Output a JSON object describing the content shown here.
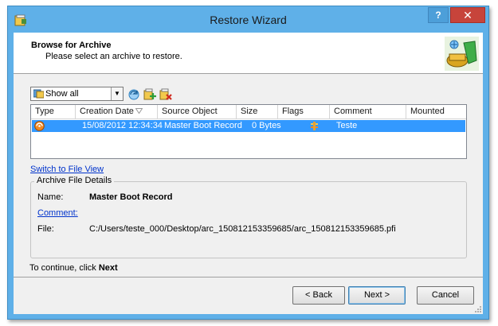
{
  "window": {
    "title": "Restore Wizard",
    "help_label": "?",
    "close_label": "✕"
  },
  "header": {
    "title": "Browse for Archive",
    "subtitle": "Please select an archive to restore."
  },
  "toolbar": {
    "filter_value": "Show all"
  },
  "list": {
    "columns": [
      "Type",
      "Creation Date",
      "Source Object",
      "Size",
      "Flags",
      "Comment",
      "Mounted"
    ],
    "rows": [
      {
        "type_icon": "archive-icon",
        "creation_date": "15/08/2012 12:34:34",
        "source_object": "Master Boot Record",
        "size": "0 Bytes",
        "flags_icon": "flag-icon",
        "comment": "Teste",
        "mounted": ""
      }
    ]
  },
  "links": {
    "switch_view": "Switch to File View"
  },
  "details": {
    "group_title": "Archive File Details",
    "name_label": "Name:",
    "name_value": "Master Boot Record",
    "comment_label": "Comment:",
    "file_label": "File:",
    "file_value": "C:/Users/teste_000/Desktop/arc_150812153359685/arc_150812153359685.pfi"
  },
  "instruction": {
    "prefix": "To continue, click ",
    "action": "Next"
  },
  "buttons": {
    "back": "< Back",
    "next": "Next >",
    "cancel": "Cancel"
  },
  "colors": {
    "titlebar": "#5fb0e8",
    "selection": "#3399ff",
    "close": "#c7443b",
    "link": "#0033cc"
  }
}
